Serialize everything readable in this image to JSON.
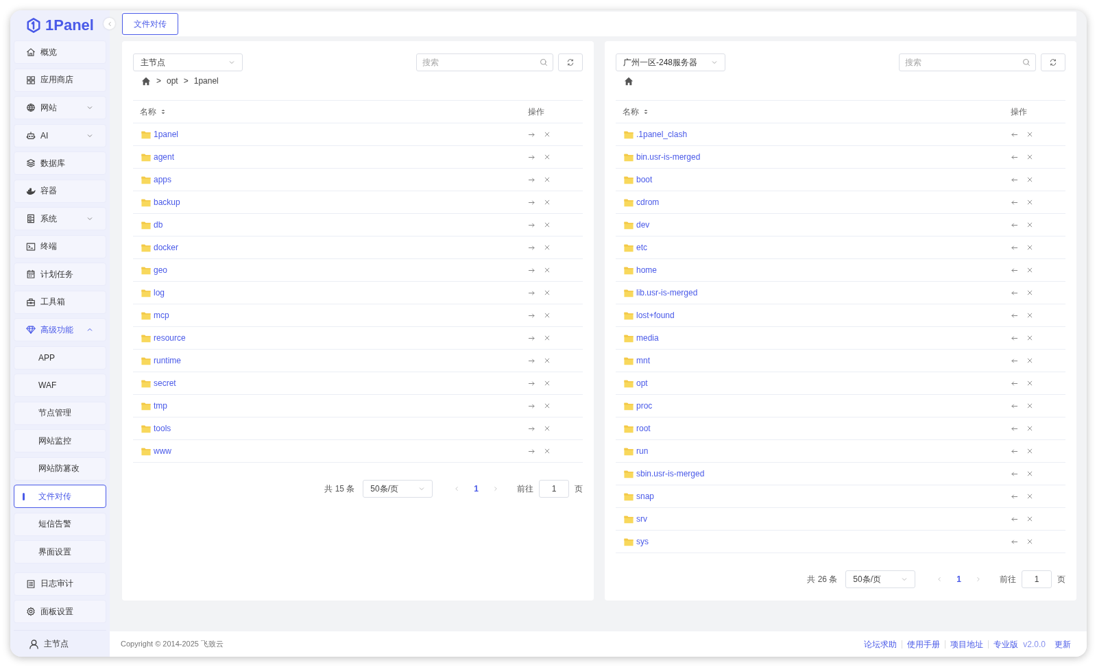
{
  "sidebar": {
    "logo": "1Panel",
    "items": [
      {
        "label": "概览",
        "selected": false
      },
      {
        "label": "应用商店",
        "selected": false
      },
      {
        "label": "网站",
        "selected": false,
        "expanded": false
      },
      {
        "label": "AI",
        "selected": false,
        "expanded": false
      },
      {
        "label": "数据库",
        "selected": false
      },
      {
        "label": "容器",
        "selected": false
      },
      {
        "label": "系统",
        "selected": false,
        "expanded": false
      },
      {
        "label": "终端",
        "selected": false
      },
      {
        "label": "计划任务",
        "selected": false
      },
      {
        "label": "工具箱",
        "selected": false
      },
      {
        "label": "高级功能",
        "selected": false,
        "expanded": true,
        "children": [
          {
            "label": "APP",
            "selected": false
          },
          {
            "label": "WAF",
            "selected": false
          },
          {
            "label": "节点管理",
            "selected": false
          },
          {
            "label": "网站监控",
            "selected": false
          },
          {
            "label": "网站防篡改",
            "selected": false
          },
          {
            "label": "文件对传",
            "selected": true
          },
          {
            "label": "短信告警",
            "selected": false
          },
          {
            "label": "界面设置",
            "selected": false
          }
        ]
      },
      {
        "label": "日志审计",
        "selected": false
      },
      {
        "label": "面板设置",
        "selected": false
      }
    ],
    "user": "主节点"
  },
  "tabs": [
    {
      "label": "文件对传",
      "selected": true
    }
  ],
  "panels": [
    {
      "node": "主节点",
      "search_placeholder": "搜索",
      "separator": ">",
      "path": [
        "opt",
        "1panel"
      ],
      "send_right": true,
      "columns": [
        "名称",
        "操作"
      ],
      "rows": [
        "1panel",
        "agent",
        "apps",
        "backup",
        "db",
        "docker",
        "geo",
        "log",
        "mcp",
        "resource",
        "runtime",
        "secret",
        "tmp",
        "tools",
        "www"
      ],
      "total": "共 15 条",
      "page_size": "50条/页",
      "page": "1",
      "goto_label": "前往",
      "goto_value": "1",
      "page_suffix": "页"
    },
    {
      "node": "广州一区-248服务器",
      "search_placeholder": "搜索",
      "send_right": false,
      "columns": [
        "名称",
        "操作"
      ],
      "rows": [
        ".1panel_clash",
        "bin.usr-is-merged",
        "boot",
        "cdrom",
        "dev",
        "etc",
        "home",
        "lib.usr-is-merged",
        "lost+found",
        "media",
        "mnt",
        "opt",
        "proc",
        "root",
        "run",
        "sbin.usr-is-merged",
        "snap",
        "srv",
        "sys"
      ],
      "total": "共 26 条",
      "page_size": "50条/页",
      "page": "1",
      "goto_label": "前往",
      "goto_value": "1",
      "page_suffix": "页"
    }
  ],
  "footer": {
    "copyright": "Copyright © 2014-2025 飞致云",
    "links": [
      "论坛求助",
      "使用手册",
      "项目地址",
      "专业版"
    ],
    "version": "v2.0.0",
    "update": "更新"
  }
}
